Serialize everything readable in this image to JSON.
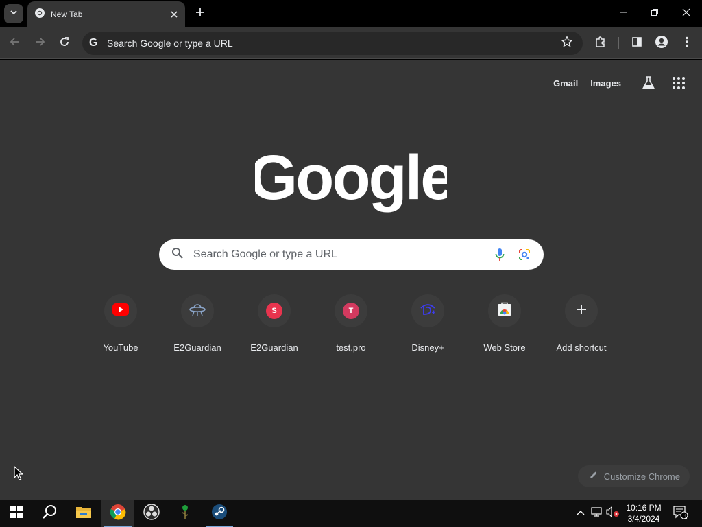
{
  "tab": {
    "title": "New Tab"
  },
  "omnibox": {
    "text": "Search Google or type a URL"
  },
  "header": {
    "gmail": "Gmail",
    "images": "Images"
  },
  "search": {
    "placeholder": "Search Google or type a URL"
  },
  "shortcuts": [
    {
      "label": "YouTube",
      "icon": "youtube-icon"
    },
    {
      "label": "E2Guardian",
      "icon": "ufo-icon"
    },
    {
      "label": "E2Guardian",
      "icon": "letter-s-icon",
      "letter": "S",
      "color": "#e8344e"
    },
    {
      "label": "test.pro",
      "icon": "letter-t-icon",
      "letter": "T",
      "color": "#d23a5f"
    },
    {
      "label": "Disney+",
      "icon": "disney-plus-icon"
    },
    {
      "label": "Web Store",
      "icon": "web-store-icon"
    },
    {
      "label": "Add shortcut",
      "icon": "plus-icon"
    }
  ],
  "customize": {
    "label": "Customize Chrome"
  },
  "taskbar": {
    "time": "10:16 PM",
    "date": "3/4/2024",
    "notification_count": "1"
  },
  "colors": {
    "content_bg": "#353535",
    "titlebar_bg": "#000000",
    "taskbar_bg": "#0f0f0f",
    "accent": "#7aa7d8"
  }
}
